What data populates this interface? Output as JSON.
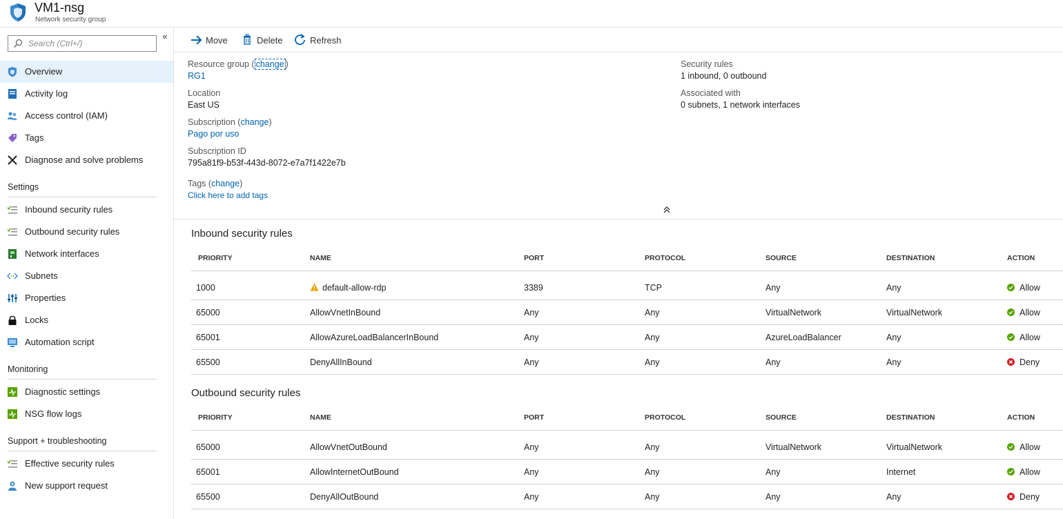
{
  "header": {
    "title": "VM1-nsg",
    "subtitle": "Network security group"
  },
  "sidebar": {
    "search_placeholder": "Search (Ctrl+/)",
    "collapse_glyph": "«",
    "top_items": [
      {
        "label": "Overview",
        "icon": "shield-icon"
      },
      {
        "label": "Activity log",
        "icon": "activity-log-icon"
      },
      {
        "label": "Access control (IAM)",
        "icon": "people-icon"
      },
      {
        "label": "Tags",
        "icon": "tag-icon"
      },
      {
        "label": "Diagnose and solve problems",
        "icon": "wrench-icon"
      }
    ],
    "sections": [
      {
        "title": "Settings",
        "items": [
          {
            "label": "Inbound security rules",
            "icon": "inbound-rules-icon"
          },
          {
            "label": "Outbound security rules",
            "icon": "outbound-rules-icon"
          },
          {
            "label": "Network interfaces",
            "icon": "network-interface-icon"
          },
          {
            "label": "Subnets",
            "icon": "subnet-icon"
          },
          {
            "label": "Properties",
            "icon": "properties-icon"
          },
          {
            "label": "Locks",
            "icon": "lock-icon"
          },
          {
            "label": "Automation script",
            "icon": "automation-script-icon"
          }
        ]
      },
      {
        "title": "Monitoring",
        "items": [
          {
            "label": "Diagnostic settings",
            "icon": "diagnostic-icon"
          },
          {
            "label": "NSG flow logs",
            "icon": "flow-logs-icon"
          }
        ]
      },
      {
        "title": "Support + troubleshooting",
        "items": [
          {
            "label": "Effective security rules",
            "icon": "effective-rules-icon"
          },
          {
            "label": "New support request",
            "icon": "support-icon"
          }
        ]
      }
    ]
  },
  "toolbar": {
    "move_label": "Move",
    "delete_label": "Delete",
    "refresh_label": "Refresh"
  },
  "essentials": {
    "resource_group_label": "Resource group",
    "resource_group_value": "RG1",
    "location_label": "Location",
    "location_value": "East US",
    "subscription_label": "Subscription",
    "subscription_value": "Pago por uso",
    "subscription_id_label": "Subscription ID",
    "subscription_id_value": "795a81f9-b53f-443d-8072-e7a7f1422e7b",
    "tags_label": "Tags",
    "tags_value": "Click here to add tags",
    "change_label": "change",
    "security_rules_label": "Security rules",
    "security_rules_value": "1 inbound, 0 outbound",
    "associated_label": "Associated with",
    "associated_value": "0 subnets, 1 network interfaces",
    "collapse_glyph": "⌃"
  },
  "columns": [
    "PRIORITY",
    "NAME",
    "PORT",
    "PROTOCOL",
    "SOURCE",
    "DESTINATION",
    "ACTION"
  ],
  "inbound": {
    "title": "Inbound security rules",
    "rows": [
      {
        "priority": "1000",
        "name": "default-allow-rdp",
        "warning": true,
        "port": "3389",
        "protocol": "TCP",
        "source": "Any",
        "destination": "Any",
        "action": "Allow"
      },
      {
        "priority": "65000",
        "name": "AllowVnetInBound",
        "warning": false,
        "port": "Any",
        "protocol": "Any",
        "source": "VirtualNetwork",
        "destination": "VirtualNetwork",
        "action": "Allow"
      },
      {
        "priority": "65001",
        "name": "AllowAzureLoadBalancerInBound",
        "warning": false,
        "port": "Any",
        "protocol": "Any",
        "source": "AzureLoadBalancer",
        "destination": "Any",
        "action": "Allow"
      },
      {
        "priority": "65500",
        "name": "DenyAllInBound",
        "warning": false,
        "port": "Any",
        "protocol": "Any",
        "source": "Any",
        "destination": "Any",
        "action": "Deny"
      }
    ]
  },
  "outbound": {
    "title": "Outbound security rules",
    "rows": [
      {
        "priority": "65000",
        "name": "AllowVnetOutBound",
        "warning": false,
        "port": "Any",
        "protocol": "Any",
        "source": "VirtualNetwork",
        "destination": "VirtualNetwork",
        "action": "Allow"
      },
      {
        "priority": "65001",
        "name": "AllowInternetOutBound",
        "warning": false,
        "port": "Any",
        "protocol": "Any",
        "source": "Any",
        "destination": "Internet",
        "action": "Allow"
      },
      {
        "priority": "65500",
        "name": "DenyAllOutBound",
        "warning": false,
        "port": "Any",
        "protocol": "Any",
        "source": "Any",
        "destination": "Any",
        "action": "Deny"
      }
    ]
  },
  "colors": {
    "accent": "#0063b1",
    "allow": "#57a300",
    "deny": "#d1202a",
    "warning": "#f19c00",
    "active_nav": "#e5f1fb"
  }
}
